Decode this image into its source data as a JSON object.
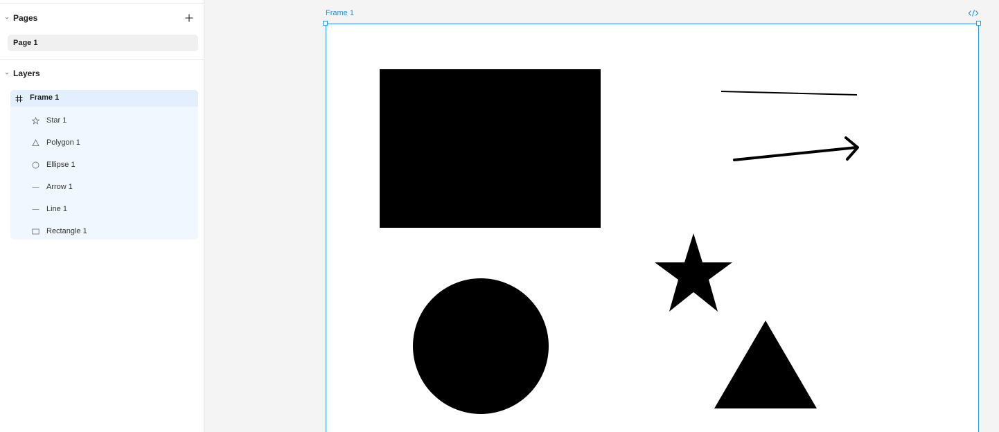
{
  "sidebar": {
    "pages": {
      "title": "Pages",
      "add_icon": "plus-icon",
      "items": [
        {
          "label": "Page 1"
        }
      ]
    },
    "layers": {
      "title": "Layers",
      "items": [
        {
          "label": "Frame 1",
          "icon": "frame-icon"
        },
        {
          "label": "Star 1",
          "icon": "star-icon"
        },
        {
          "label": "Polygon 1",
          "icon": "polygon-icon"
        },
        {
          "label": "Ellipse 1",
          "icon": "ellipse-icon"
        },
        {
          "label": "Arrow 1",
          "icon": "arrow-icon"
        },
        {
          "label": "Line 1",
          "icon": "line-icon"
        },
        {
          "label": "Rectangle 1",
          "icon": "rectangle-icon"
        }
      ]
    }
  },
  "canvas": {
    "frame_label": "Frame 1",
    "code_icon": "code-icon",
    "selection_color": "#2d9ae6",
    "shape_fill": "#000000"
  },
  "colors": {
    "accent": "#1d8fe0",
    "layer_selected_bg": "#e3effc",
    "layer_child_bg": "#f0f7fe",
    "canvas_bg": "#f4f4f4"
  }
}
